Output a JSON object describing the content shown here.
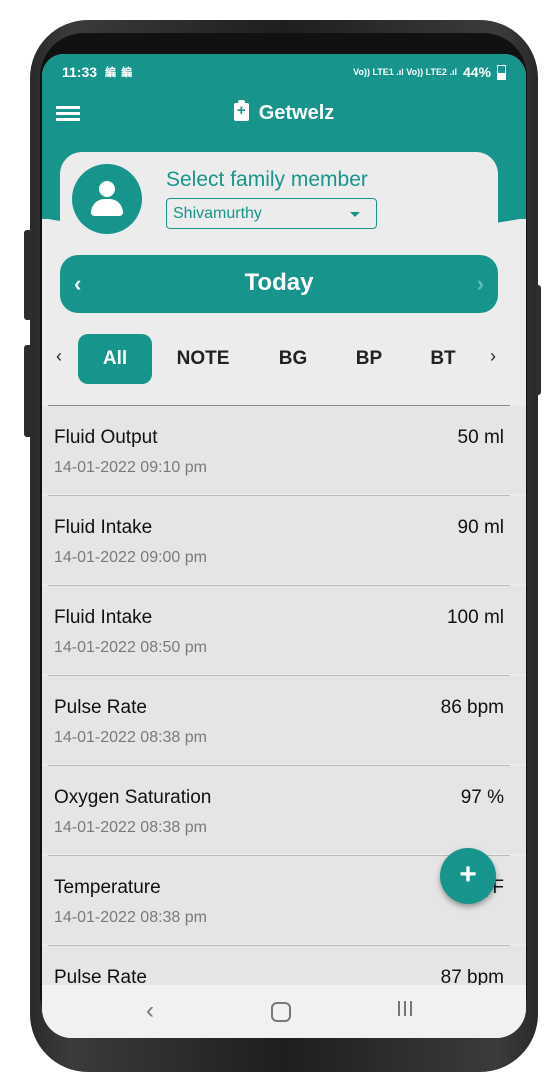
{
  "status_bar": {
    "time": "11:33",
    "sim_icons": "編 編",
    "signal_text": "Vo)) LTE1 .ıl Vo)) LTE2 .ıl",
    "battery": "44%"
  },
  "app": {
    "title": "Getwelz",
    "primary_color": "#17958c"
  },
  "member": {
    "label": "Select family member",
    "selected": "Shivamurthy"
  },
  "date_nav": {
    "prev": "‹",
    "label": "Today",
    "next": "›"
  },
  "filter_tabs": {
    "left_arrow": "‹",
    "right_arrow": "›",
    "items": [
      "All",
      "NOTE",
      "BG",
      "BP",
      "BT"
    ],
    "active": "All"
  },
  "records": [
    {
      "name": "Fluid Output",
      "value": "50 ml",
      "datetime": "14-01-2022 09:10 pm"
    },
    {
      "name": "Fluid Intake",
      "value": "90 ml",
      "datetime": "14-01-2022 09:00 pm"
    },
    {
      "name": "Fluid Intake",
      "value": "100 ml",
      "datetime": "14-01-2022 08:50 pm"
    },
    {
      "name": "Pulse Rate",
      "value": "86 bpm",
      "datetime": "14-01-2022 08:38 pm"
    },
    {
      "name": "Oxygen Saturation",
      "value": "97 %",
      "datetime": "14-01-2022 08:38 pm"
    },
    {
      "name": "Temperature",
      "value": "9_ F",
      "datetime": "14-01-2022 08:38 pm"
    },
    {
      "name": "Pulse Rate",
      "value": "87 bpm",
      "datetime": ""
    }
  ],
  "fab": {
    "label": "+"
  },
  "nav_bar": {
    "back": "‹"
  }
}
